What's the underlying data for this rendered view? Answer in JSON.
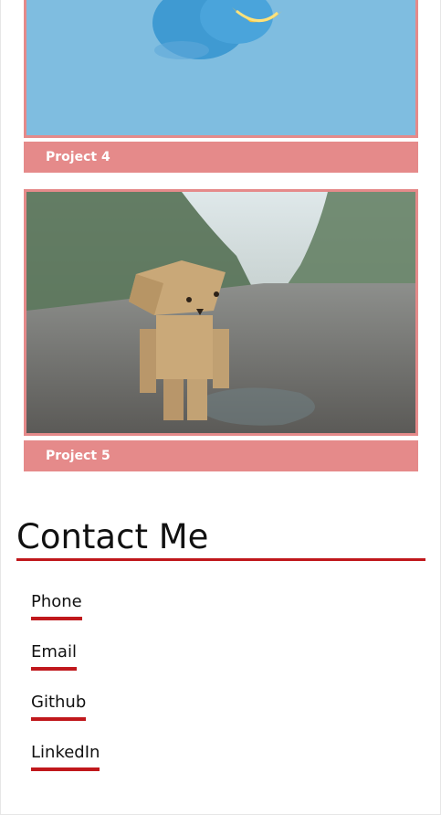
{
  "projects": [
    {
      "caption": "Project 4",
      "image": "blue-fruit-photo"
    },
    {
      "caption": "Project 5",
      "image": "cardboard-robot-photo"
    }
  ],
  "contact": {
    "title": "Contact Me",
    "links": [
      {
        "label": "Phone"
      },
      {
        "label": "Email"
      },
      {
        "label": "Github"
      },
      {
        "label": "LinkedIn"
      }
    ]
  },
  "colors": {
    "caption_bg": "#e58a8a",
    "accent_underline": "#c0181c",
    "sky_blue": "#7fbde0"
  }
}
